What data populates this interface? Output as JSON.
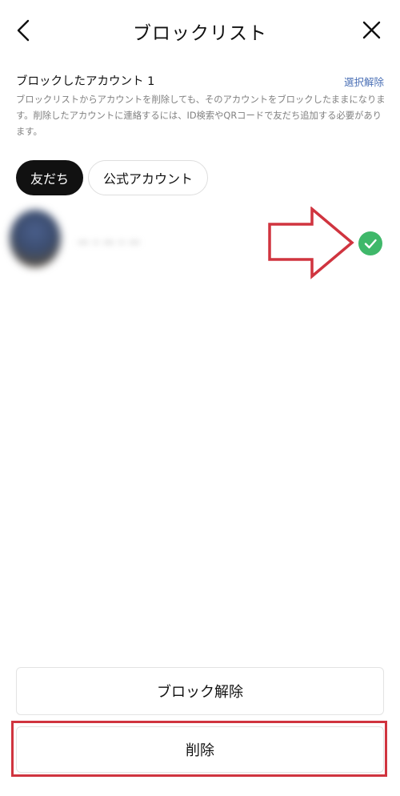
{
  "header": {
    "title": "ブロックリスト",
    "back_icon": "chevron-left-icon",
    "close_icon": "close-icon"
  },
  "info": {
    "heading": "ブロックしたアカウント 1",
    "unselect_label": "選択解除",
    "description": "ブロックリストからアカウントを削除しても、そのアカウントをブロックしたままになります。削除したアカウントに連絡するには、ID検索やQRコードで友だち追加する必要があります。"
  },
  "tabs": [
    {
      "label": "友だち",
      "selected": true
    },
    {
      "label": "公式アカウント",
      "selected": false
    }
  ],
  "accounts": [
    {
      "name": "ー・ー・ー",
      "selected": true
    }
  ],
  "buttons": {
    "unblock_label": "ブロック解除",
    "delete_label": "削除"
  },
  "colors": {
    "accent_check": "#3fb86a",
    "link": "#4a6fb5",
    "annotation_red": "#d0343f",
    "tab_selected_bg": "#111111"
  }
}
